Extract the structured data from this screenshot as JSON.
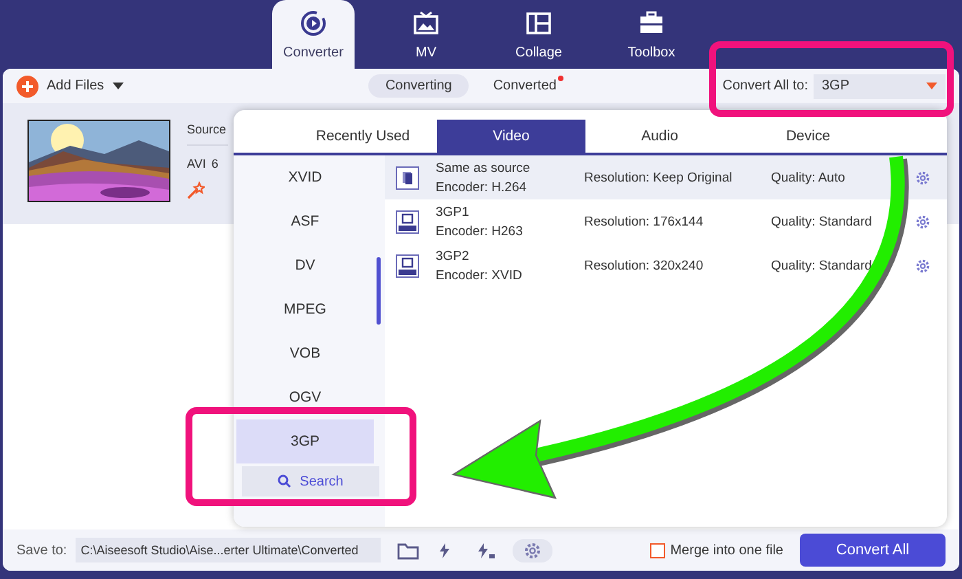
{
  "nav_tabs": [
    {
      "label": "Converter",
      "selected": true,
      "kind": "converter"
    },
    {
      "label": "MV",
      "selected": false,
      "kind": "mv"
    },
    {
      "label": "Collage",
      "selected": false,
      "kind": "collage"
    },
    {
      "label": "Toolbox",
      "selected": false,
      "kind": "toolbox"
    }
  ],
  "toolbar": {
    "add_files": "Add Files",
    "views": [
      {
        "label": "Converting",
        "selected": true,
        "badge": false
      },
      {
        "label": "Converted",
        "selected": false,
        "badge": true
      }
    ],
    "convert_all_label": "Convert All to:",
    "convert_all_value": "3GP"
  },
  "file": {
    "source_label": "Source",
    "format": "AVI",
    "size": "6"
  },
  "format_popup": {
    "tabs": [
      {
        "label": "Recently Used",
        "selected": false
      },
      {
        "label": "Video",
        "selected": true
      },
      {
        "label": "Audio",
        "selected": false
      },
      {
        "label": "Device",
        "selected": false
      }
    ],
    "formats": [
      {
        "label": "XVID",
        "selected": false
      },
      {
        "label": "ASF",
        "selected": false
      },
      {
        "label": "DV",
        "selected": false
      },
      {
        "label": "MPEG",
        "selected": false
      },
      {
        "label": "VOB",
        "selected": false
      },
      {
        "label": "OGV",
        "selected": false
      },
      {
        "label": "3GP",
        "selected": true
      }
    ],
    "search": "Search",
    "presets": [
      {
        "name": "Same as source",
        "encoder": "Encoder: H.264",
        "resolution": "Resolution: Keep Original",
        "quality": "Quality: Auto",
        "selected": true,
        "kind": "source"
      },
      {
        "name": "3GP1",
        "encoder": "Encoder: H263",
        "resolution": "Resolution: 176x144",
        "quality": "Quality: Standard",
        "selected": false,
        "kind": "file"
      },
      {
        "name": "3GP2",
        "encoder": "Encoder: XVID",
        "resolution": "Resolution: 320x240",
        "quality": "Quality: Standard",
        "selected": false,
        "kind": "file"
      }
    ]
  },
  "bottom_bar": {
    "save_to_label": "Save to:",
    "path": "C:\\Aiseesoft Studio\\Aise...erter Ultimate\\Converted",
    "merge_label": "Merge into one file",
    "merge_checked": false,
    "convert_button": "Convert All"
  }
}
